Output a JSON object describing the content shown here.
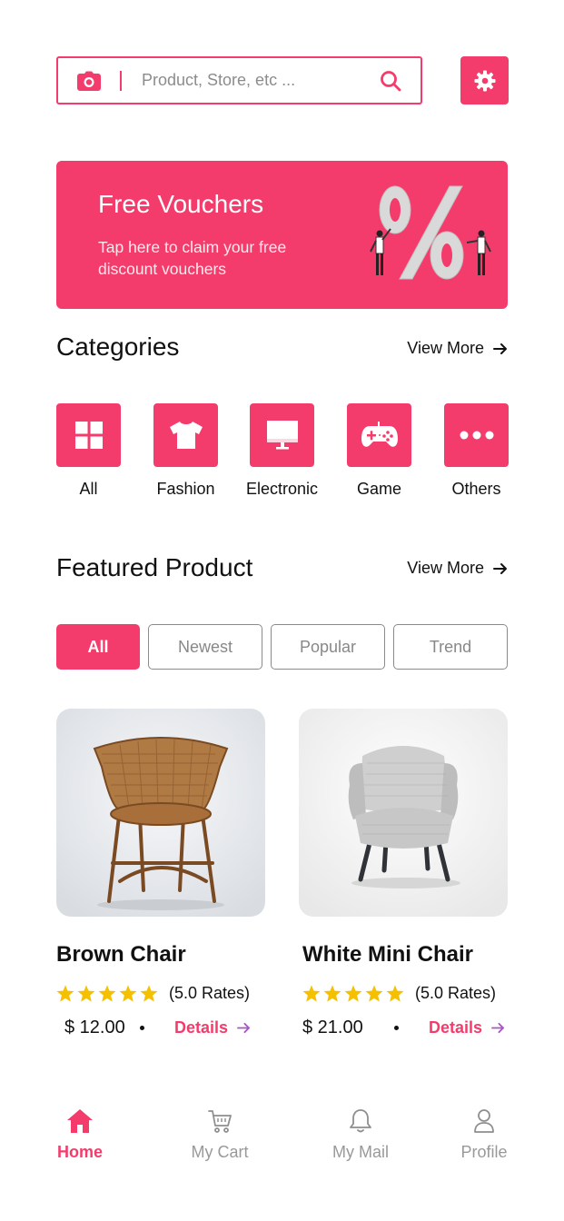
{
  "colors": {
    "accent": "#f43c6c",
    "text": "#111111",
    "muted": "#999999",
    "star": "#f5c000"
  },
  "search": {
    "placeholder": "Product, Store, etc ..."
  },
  "banner": {
    "title": "Free Vouchers",
    "description": "Tap here to claim your free discount vouchers"
  },
  "categories": {
    "title": "Categories",
    "view_more": "View More",
    "items": [
      {
        "label": "All",
        "icon": "grid-icon"
      },
      {
        "label": "Fashion",
        "icon": "tshirt-icon"
      },
      {
        "label": "Electronic",
        "icon": "monitor-icon"
      },
      {
        "label": "Game",
        "icon": "gamepad-icon"
      },
      {
        "label": "Others",
        "icon": "more-icon"
      }
    ]
  },
  "featured": {
    "title": "Featured Product",
    "view_more": "View More",
    "filters": [
      "All",
      "Newest",
      "Popular",
      "Trend"
    ],
    "active_filter": "All",
    "products": [
      {
        "name": "Brown Chair",
        "rating": 5,
        "rates": "(5.0 Rates)",
        "price": "$ 12.00",
        "details": "Details"
      },
      {
        "name": "White Mini Chair",
        "rating": 5,
        "rates": "(5.0 Rates)",
        "price": "$ 21.00",
        "details": "Details"
      }
    ]
  },
  "nav": {
    "active": "Home",
    "items": [
      {
        "label": "Home",
        "icon": "home-icon"
      },
      {
        "label": "My Cart",
        "icon": "cart-icon"
      },
      {
        "label": "My Mail",
        "icon": "bell-icon"
      },
      {
        "label": "Profile",
        "icon": "user-icon"
      }
    ]
  }
}
